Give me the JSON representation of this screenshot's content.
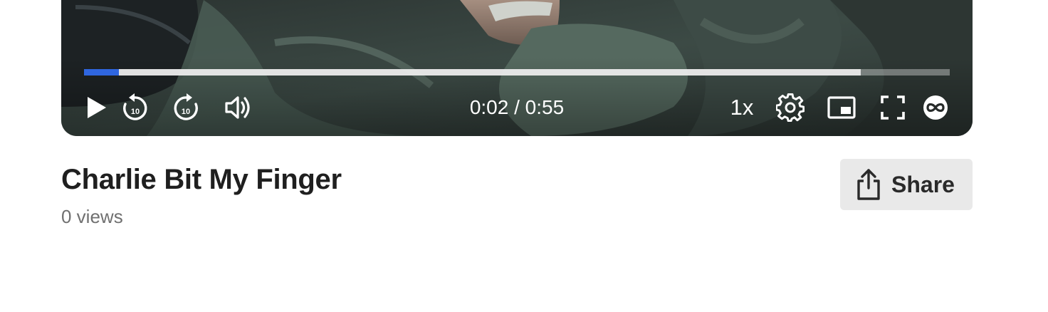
{
  "player": {
    "time_display": "0:02 / 0:55",
    "speed_label": "1x",
    "progress": {
      "played_fraction": 0.04,
      "buffered_fraction": 0.897
    },
    "rewind_seconds_label": "10",
    "forward_seconds_label": "10"
  },
  "video": {
    "title": "Charlie Bit My Finger",
    "views": "0 views"
  },
  "share": {
    "label": "Share"
  },
  "colors": {
    "accent": "#2f66e0",
    "share_bg": "#e9e9e9",
    "title": "#1f1f1f",
    "views": "#707070"
  },
  "icons": {
    "play": "play-icon",
    "rewind": "rewind-10-icon",
    "forward": "forward-10-icon",
    "volume": "volume-icon",
    "settings": "gear-icon",
    "pip": "picture-in-picture-icon",
    "fullscreen": "fullscreen-icon",
    "cast": "loop-icon",
    "share": "share-icon"
  }
}
